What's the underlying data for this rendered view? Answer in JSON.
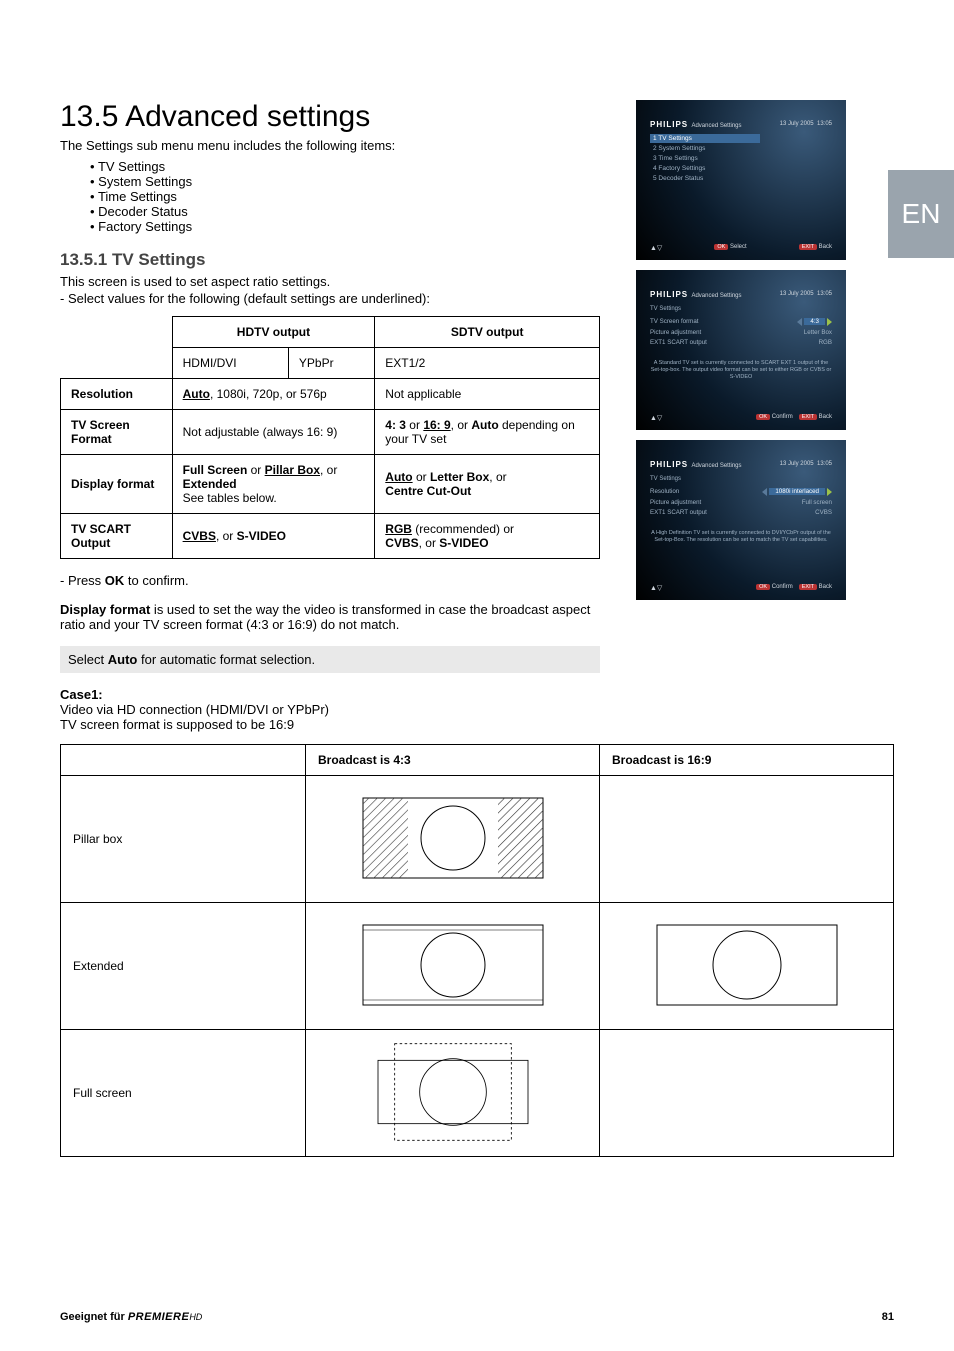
{
  "lang_tab": "EN",
  "heading": "13.5 Advanced settings",
  "intro": "The Settings sub menu menu includes the following items:",
  "sub_items": [
    "TV Settings",
    "System Settings",
    "Time Settings",
    "Decoder Status",
    "Factory Settings"
  ],
  "sec_1_title": "13.5.1 TV Settings",
  "sec_1_desc1": "This screen is used to set aspect ratio settings.",
  "sec_1_desc2": "Select values for the following (default settings are underlined):",
  "spec_table": {
    "headers": {
      "hdtv": "HDTV output",
      "sdtv": "SDTV output",
      "hdmi": "HDMI/DVI",
      "ypbpr": "YPbPr",
      "ext": "EXT1/2"
    },
    "rows": {
      "resolution": {
        "label": "Resolution",
        "hdtv_pre": "Auto",
        "hdtv_post": ", 1080i, 720p, or 576p",
        "sdtv": "Not applicable"
      },
      "screen_fmt": {
        "label": "TV Screen Format",
        "hdtv": "Not adjustable (always 16: 9)",
        "sdtv_pre1": "4: 3",
        "sdtv_mid": " or ",
        "sdtv_pre2": "16: 9",
        "sdtv_mid2": ", or ",
        "sdtv_pre3": "Auto",
        "sdtv_post": " depending on your TV set"
      },
      "disp_fmt": {
        "label": "Display format",
        "hdtv_p1": "Full Screen",
        "hdtv_or1": " or ",
        "hdtv_p2": "Pillar Box",
        "hdtv_or2": ", or ",
        "hdtv_p3": "Extended",
        "hdtv_post": "See tables below.",
        "sdtv_p1": "Auto",
        "sdtv_or1": " or ",
        "sdtv_p2": "Letter Box",
        "sdtv_or2": ", or ",
        "sdtv_p3": "Centre Cut-Out"
      },
      "scart": {
        "label": "TV SCART Output",
        "hdtv_p1": "CVBS",
        "hdtv_or": ", or ",
        "hdtv_p2": "S-VIDEO",
        "sdtv_p1": "RGB",
        "sdtv_post1": " (recommended) or ",
        "sdtv_p2": "CVBS",
        "sdtv_or": ", or ",
        "sdtv_p3": "S-VIDEO"
      }
    }
  },
  "press_ok": "Press ",
  "press_ok_btn": "OK",
  "press_ok_post": " to confirm.",
  "disp_fmt_para_pre": "Display format",
  "disp_fmt_para_post": " is used to set the way the video is transformed in case the broadcast aspect ratio and your TV screen format (4:3 or 16:9) do not match.",
  "grayband_pre": " Select ",
  "grayband_b": "Auto",
  "grayband_post": " for automatic format selection.",
  "case1_title": "Case1:",
  "case1_l1": "Video via HD connection (HDMI/DVI or YPbPr)",
  "case1_l2": "TV screen format is supposed to be 16:9",
  "fmt_table": {
    "headers": {
      "c1": "",
      "c2": "Broadcast is 4:3",
      "c3": "Broadcast is 16:9"
    },
    "rows": [
      "Pillar box",
      "Extended",
      "Full screen"
    ]
  },
  "footer": {
    "left_pre": "Geeignet für ",
    "left_brand": "PREMIERE",
    "left_suffix": "HD",
    "page_no": "81"
  },
  "osd": {
    "brand": "PHILIPS",
    "crumb": "Advanced Settings",
    "date": "13 July 2005",
    "time": "13:05",
    "menu1": [
      "1  TV Settings",
      "2  System Settings",
      "3  Time Settings",
      "4  Factory Settings",
      "5  Decoder Status"
    ],
    "hints_select": "Select",
    "hints_back": "Back",
    "hints_confirm": "Confirm",
    "hints_ok": "OK",
    "hints_exit": "EXIT",
    "kv2": {
      "sub": "TV Settings",
      "rows": [
        {
          "k": "TV Screen format",
          "v": "4:3",
          "hl": true
        },
        {
          "k": "Picture adjustment",
          "v": "Letter Box"
        },
        {
          "k": "EXT1 SCART output",
          "v": "RGB"
        }
      ],
      "note": "A Standard TV set is currently connected to SCART EXT 1 output of the Set-top-box. The output video format can be set to either RGB or CVBS or S-VIDEO"
    },
    "kv3": {
      "sub": "TV Settings",
      "rows": [
        {
          "k": "Resolution",
          "v": "1080i interlaced",
          "hl": true
        },
        {
          "k": "Picture adjustment",
          "v": "Full screen"
        },
        {
          "k": "EXT1 SCART output",
          "v": "CVBS"
        }
      ],
      "note": "A High Definition TV set is currently connected to DVI/YCbPr output of the Set-top-Box. The resolution can be set to match the TV set capabilities."
    }
  }
}
